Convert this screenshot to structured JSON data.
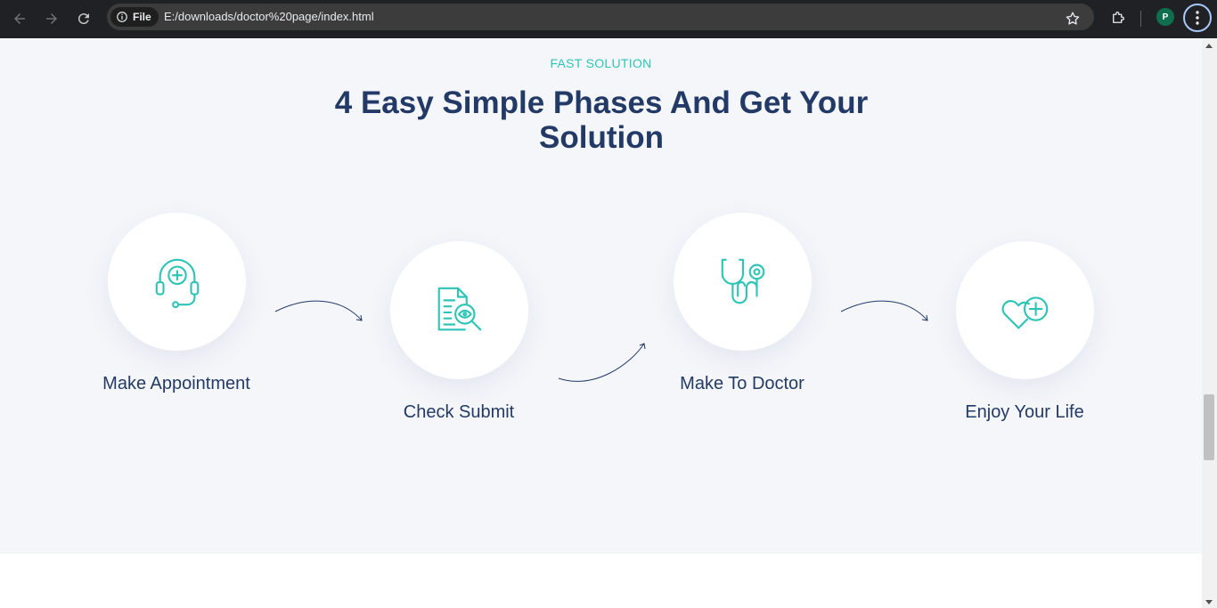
{
  "browser": {
    "chip_label": "File",
    "url": "E:/downloads/doctor%20page/index.html",
    "profile_initial": "P"
  },
  "section": {
    "eyebrow": "FAST SOLUTION",
    "heading": "4 Easy Simple Phases And Get Your Solution",
    "steps": [
      {
        "label": "Make Appointment",
        "icon": "headset-medical-icon"
      },
      {
        "label": "Check Submit",
        "icon": "document-search-icon"
      },
      {
        "label": "Make To Doctor",
        "icon": "stethoscope-icon"
      },
      {
        "label": "Enjoy Your Life",
        "icon": "heart-plus-icon"
      }
    ]
  },
  "colors": {
    "accent": "#2ec4b6",
    "heading": "#233a66",
    "section_bg": "#f4f6fa"
  }
}
